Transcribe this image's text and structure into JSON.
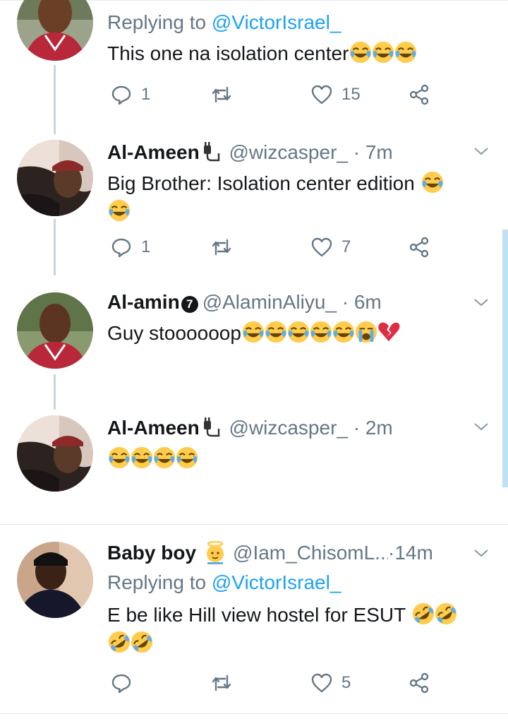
{
  "tweets": [
    {
      "replying_prefix": "Replying to ",
      "replying_to": "@VictorIsrael_",
      "text": "This one na isolation center",
      "emojis": [
        "face-with-tears-of-joy",
        "face-with-tears-of-joy",
        "face-with-tears-of-joy"
      ],
      "replies": "1",
      "likes": "15"
    },
    {
      "name": "Al-Ameen",
      "name_icon": "plug-icon",
      "handle": "@wizcasper_",
      "time": "7m",
      "text": "Big Brother: Isolation center edition",
      "emojis": [
        "face-with-tears-of-joy",
        "face-with-tears-of-joy"
      ],
      "replies": "1",
      "likes": "7"
    },
    {
      "name": "Al-amin",
      "name_badge": "7",
      "handle": "@AlaminAliyu_",
      "time": "6m",
      "text": "Guy stoooooop",
      "emojis": [
        "face-with-tears-of-joy",
        "face-with-tears-of-joy",
        "face-with-tears-of-joy",
        "face-with-tears-of-joy",
        "face-with-tears-of-joy",
        "loudly-crying-face",
        "broken-heart"
      ]
    },
    {
      "name": "Al-Ameen",
      "name_icon": "plug-icon",
      "handle": "@wizcasper_",
      "time": "2m",
      "emojis": [
        "face-with-tears-of-joy",
        "face-with-tears-of-joy",
        "face-with-tears-of-joy",
        "face-with-tears-of-joy"
      ]
    },
    {
      "name": "Baby boy",
      "name_icon": "baby-angel-icon",
      "handle": "@Iam_ChisomL...",
      "time": "14m",
      "replying_prefix": "Replying to ",
      "replying_to": "@VictorIsrael_",
      "text": "E be like Hill view hostel for ESUT",
      "emojis": [
        "rolling-on-floor-laughing",
        "rolling-on-floor-laughing",
        "rolling-on-floor-laughing",
        "rolling-on-floor-laughing"
      ],
      "likes": "5"
    }
  ],
  "dot_sep": " · ",
  "colors": {
    "accent": "#1da1f2",
    "muted": "#657786",
    "line": "#ccd6dd",
    "emoji": "#f7c22f"
  }
}
